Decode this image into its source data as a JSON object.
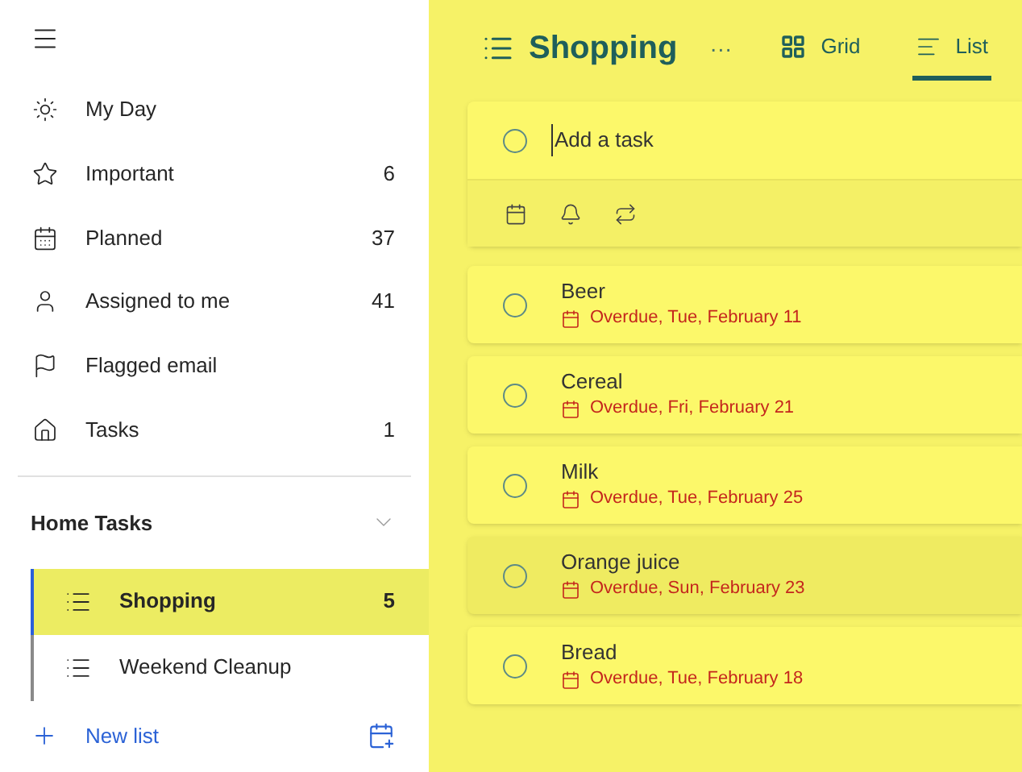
{
  "sidebar": {
    "items": [
      {
        "label": "My Day"
      },
      {
        "label": "Important",
        "count": "6"
      },
      {
        "label": "Planned",
        "count": "37"
      },
      {
        "label": "Assigned to me",
        "count": "41"
      },
      {
        "label": "Flagged email"
      },
      {
        "label": "Tasks",
        "count": "1"
      }
    ],
    "group": {
      "title": "Home Tasks",
      "expanded": true,
      "lists": [
        {
          "label": "Shopping",
          "count": "5",
          "selected": true
        },
        {
          "label": "Weekend Cleanup",
          "selected": false
        }
      ]
    },
    "new_list": "New list"
  },
  "header": {
    "title": "Shopping",
    "more": "···",
    "views": [
      {
        "label": "Grid",
        "selected": false
      },
      {
        "label": "List",
        "selected": true
      }
    ]
  },
  "add_task": {
    "placeholder": "Add a task",
    "checked": false
  },
  "tasks": [
    {
      "title": "Beer",
      "due": "Overdue, Tue, February 11",
      "hovered": false,
      "checked": false
    },
    {
      "title": "Cereal",
      "due": "Overdue, Fri, February 21",
      "hovered": false,
      "checked": false
    },
    {
      "title": "Milk",
      "due": "Overdue, Tue, February 25",
      "hovered": false,
      "checked": false
    },
    {
      "title": "Orange juice",
      "due": "Overdue, Sun, February 23",
      "hovered": true,
      "checked": false
    },
    {
      "title": "Bread",
      "due": "Overdue, Tue, February 18",
      "hovered": false,
      "checked": false
    }
  ]
}
